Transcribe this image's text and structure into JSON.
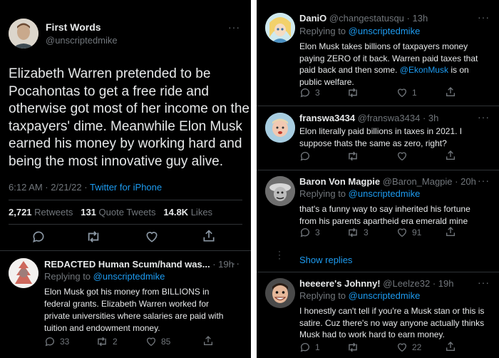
{
  "main_tweet": {
    "display_name": "First Words",
    "handle": "@unscriptedmike",
    "text_lines": [
      "Elizabeth Warren pretended to be",
      "Pocahontas to get a free ride and",
      "otherwise got most of her income on the",
      "taxpayers' dime. Meanwhile Elon Musk",
      "earned his money by working hard and",
      "being the most innovative guy alive."
    ],
    "time": "6:12 AM · 2/21/22 ·",
    "source": "Twitter for iPhone",
    "stats": {
      "retweets_count": "2,721",
      "retweets_label": "Retweets",
      "quotes_count": "131",
      "quotes_label": "Quote Tweets",
      "likes_count": "14.8K",
      "likes_label": "Likes"
    },
    "more_label": "···"
  },
  "replies": [
    {
      "display_name": "REDACTED Human Scum/hand was...",
      "handle": "",
      "time": "· 19h",
      "replying_prefix": "Replying to",
      "replying_to": "@unscriptedmike",
      "text_lines": [
        "Elon Musk got his money from BILLIONS in",
        "federal grants. Elizabeth Warren worked for",
        "private universities where salaries are paid with",
        "tuition and endowment money."
      ],
      "counts": {
        "replies": "33",
        "retweets": "2",
        "likes": "85"
      }
    },
    {
      "display_name": "DaniO",
      "handle": "@changestatusqu",
      "time": "· 13h",
      "replying_prefix": "Replying to",
      "replying_to": "@unscriptedmike",
      "text_lines": [
        "Elon Musk takes billions of taxpayers money",
        "paying ZERO of it back. Warren paid taxes that",
        "paid back and then some.",
        "public welfare."
      ],
      "mention": "@EkonMusk",
      "mention_suffix": "is on",
      "counts": {
        "replies": "3",
        "retweets": "",
        "likes": "1"
      }
    },
    {
      "display_name": "franswa3434",
      "handle": "@franswa3434",
      "time": "· 3h",
      "text_lines": [
        "Elon literally paid billions in taxes in 2021. I",
        "suppose thats the same as zero, right?"
      ],
      "counts": {
        "replies": "",
        "retweets": "",
        "likes": ""
      }
    },
    {
      "display_name": "Baron Von Magpie",
      "handle": "@Baron_Magpie",
      "time": "· 20h",
      "replying_prefix": "Replying to",
      "replying_to": "@unscriptedmike",
      "text_lines": [
        "that's a funny way to say inherited his fortune",
        "from his parents apartheid era emerald mine"
      ],
      "counts": {
        "replies": "3",
        "retweets": "3",
        "likes": "91"
      }
    },
    {
      "display_name": "heeeere's Johnny!",
      "handle": "@Leelze32",
      "time": "· 19h",
      "replying_prefix": "Replying to",
      "replying_to": "@unscriptedmike",
      "text_lines": [
        "I honestly can't tell if you're a Musk stan or this is",
        "satire. Cuz there's no way anyone actually thinks",
        "Musk had to work hard to earn money."
      ],
      "counts": {
        "replies": "1",
        "retweets": "",
        "likes": "22"
      }
    }
  ],
  "show_replies_label": "Show replies",
  "more_label": "···",
  "colors": {
    "background": "#000000",
    "text": "#e7e9ea",
    "muted": "#71767b",
    "link": "#1d9bf0",
    "divider": "#2f3336"
  }
}
